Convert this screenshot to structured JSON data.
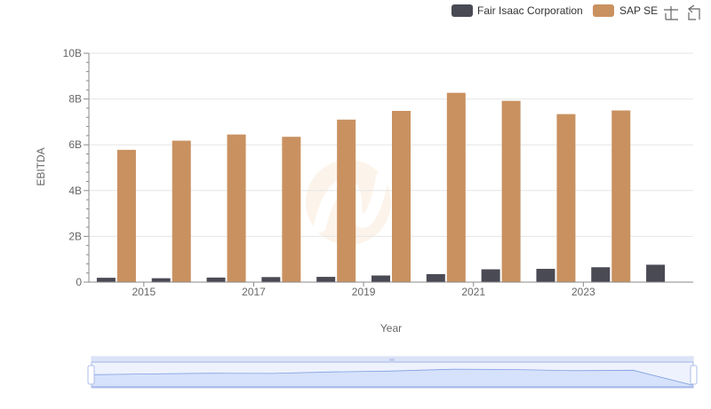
{
  "chart_data": {
    "type": "bar",
    "xlabel": "Year",
    "ylabel": "EBITDA",
    "x_tick_labels": [
      "2015",
      "2017",
      "2019",
      "2021",
      "2023"
    ],
    "y_tick_labels": [
      "0",
      "2B",
      "4B",
      "6B",
      "8B",
      "10B"
    ],
    "ylim": [
      0,
      10000000000
    ],
    "categories": [
      "2014",
      "2015",
      "2016",
      "2017",
      "2018",
      "2019",
      "2020",
      "2021",
      "2022",
      "2023",
      "2024"
    ],
    "series": [
      {
        "name": "Fair Isaac Corporation",
        "color": "#4a4a55",
        "values": [
          190000000,
          170000000,
          200000000,
          220000000,
          230000000,
          290000000,
          350000000,
          560000000,
          580000000,
          650000000,
          760000000
        ]
      },
      {
        "name": "SAP SE",
        "color": "#c99160",
        "values": [
          5780000000,
          6180000000,
          6450000000,
          6350000000,
          7100000000,
          7480000000,
          8270000000,
          7920000000,
          7340000000,
          7500000000,
          null
        ]
      }
    ],
    "grid": true,
    "legend": "top-right"
  },
  "icons": {
    "zoom": "zoom-crosshair-icon",
    "reset": "zoom-reset-icon"
  },
  "slider": {
    "fill": "#d6e1fb",
    "border": "#aebde8",
    "line": "#7f9fe0"
  }
}
